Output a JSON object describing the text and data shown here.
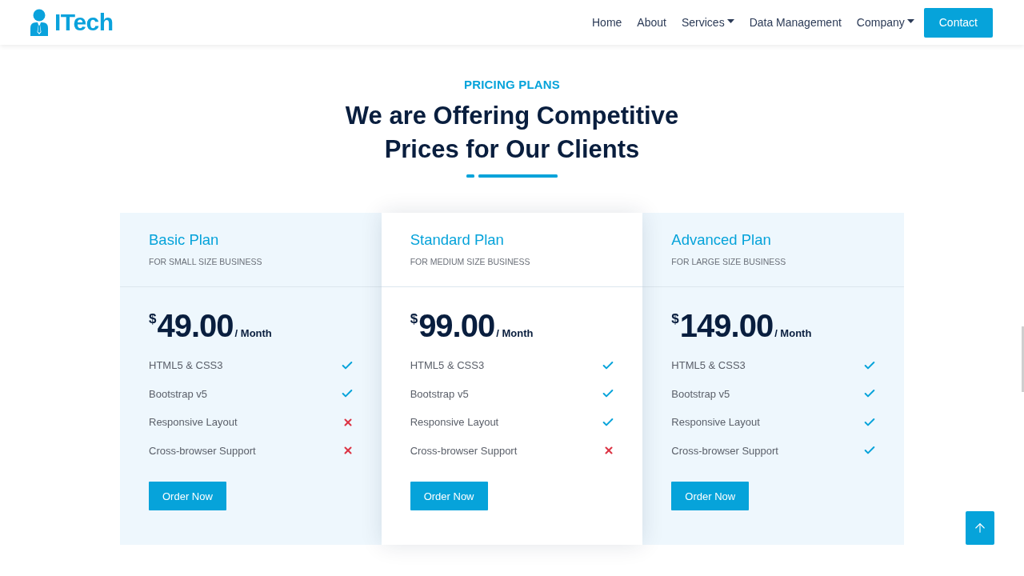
{
  "header": {
    "brand": "ITech",
    "nav": [
      {
        "label": "Home",
        "has_menu": false
      },
      {
        "label": "About",
        "has_menu": false
      },
      {
        "label": "Services",
        "has_menu": true
      },
      {
        "label": "Data Management",
        "has_menu": false
      },
      {
        "label": "Company",
        "has_menu": true
      }
    ],
    "cta": "Contact"
  },
  "section": {
    "eyebrow": "PRICING PLANS",
    "title_lines": [
      "We are Offering Competitive",
      "Prices for Our Clients"
    ]
  },
  "plans": [
    {
      "name": "Basic Plan",
      "subtitle": "FOR SMALL SIZE BUSINESS",
      "currency": "$",
      "price": "49.00",
      "period": "/ Month",
      "featured": false,
      "features": [
        {
          "label": "HTML5 & CSS3",
          "included": true
        },
        {
          "label": "Bootstrap v5",
          "included": true
        },
        {
          "label": "Responsive Layout",
          "included": false
        },
        {
          "label": "Cross-browser Support",
          "included": false
        }
      ],
      "button": "Order Now"
    },
    {
      "name": "Standard Plan",
      "subtitle": "FOR MEDIUM SIZE BUSINESS",
      "currency": "$",
      "price": "99.00",
      "period": "/ Month",
      "featured": true,
      "features": [
        {
          "label": "HTML5 & CSS3",
          "included": true
        },
        {
          "label": "Bootstrap v5",
          "included": true
        },
        {
          "label": "Responsive Layout",
          "included": true
        },
        {
          "label": "Cross-browser Support",
          "included": false
        }
      ],
      "button": "Order Now"
    },
    {
      "name": "Advanced Plan",
      "subtitle": "FOR LARGE SIZE BUSINESS",
      "currency": "$",
      "price": "149.00",
      "period": "/ Month",
      "featured": false,
      "features": [
        {
          "label": "HTML5 & CSS3",
          "included": true
        },
        {
          "label": "Bootstrap v5",
          "included": true
        },
        {
          "label": "Responsive Layout",
          "included": true
        },
        {
          "label": "Cross-browser Support",
          "included": true
        }
      ],
      "button": "Order Now"
    }
  ]
}
